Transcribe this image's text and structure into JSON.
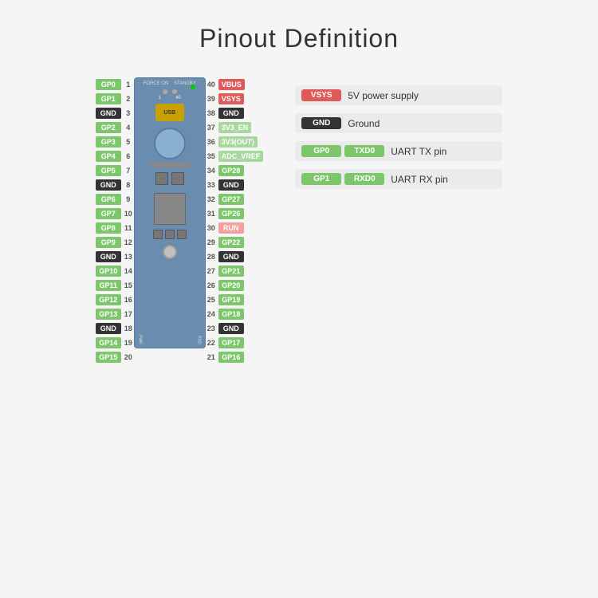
{
  "title": "Pinout Definition",
  "left_pins": [
    {
      "label": "GP0",
      "num": "1",
      "color": "green"
    },
    {
      "label": "GP1",
      "num": "2",
      "color": "green"
    },
    {
      "label": "GND",
      "num": "3",
      "color": "black"
    },
    {
      "label": "GP2",
      "num": "4",
      "color": "green"
    },
    {
      "label": "GP3",
      "num": "5",
      "color": "green"
    },
    {
      "label": "GP4",
      "num": "6",
      "color": "green"
    },
    {
      "label": "GP5",
      "num": "7",
      "color": "green"
    },
    {
      "label": "GND",
      "num": "8",
      "color": "black"
    },
    {
      "label": "GP6",
      "num": "9",
      "color": "green"
    },
    {
      "label": "GP7",
      "num": "10",
      "color": "green"
    },
    {
      "label": "GP8",
      "num": "11",
      "color": "green"
    },
    {
      "label": "GP9",
      "num": "12",
      "color": "green"
    },
    {
      "label": "GND",
      "num": "13",
      "color": "black"
    },
    {
      "label": "GP10",
      "num": "14",
      "color": "green"
    },
    {
      "label": "GP11",
      "num": "15",
      "color": "green"
    },
    {
      "label": "GP12",
      "num": "16",
      "color": "green"
    },
    {
      "label": "GP13",
      "num": "17",
      "color": "green"
    },
    {
      "label": "GND",
      "num": "18",
      "color": "black"
    },
    {
      "label": "GP14",
      "num": "19",
      "color": "green"
    },
    {
      "label": "GP15",
      "num": "20",
      "color": "green"
    }
  ],
  "right_pins": [
    {
      "label": "VBUS",
      "num": "40",
      "color": "red"
    },
    {
      "label": "VSYS",
      "num": "39",
      "color": "red"
    },
    {
      "label": "GND",
      "num": "38",
      "color": "black"
    },
    {
      "label": "3V3_EN",
      "num": "37",
      "color": "light-green"
    },
    {
      "label": "3V3(OUT)",
      "num": "36",
      "color": "light-green"
    },
    {
      "label": "ADC_VREF",
      "num": "35",
      "color": "light-green"
    },
    {
      "label": "GP28",
      "num": "34",
      "color": "green"
    },
    {
      "label": "GND",
      "num": "33",
      "color": "black"
    },
    {
      "label": "GP27",
      "num": "32",
      "color": "green"
    },
    {
      "label": "GP26",
      "num": "31",
      "color": "green"
    },
    {
      "label": "RUN",
      "num": "30",
      "color": "pink"
    },
    {
      "label": "GP22",
      "num": "29",
      "color": "green"
    },
    {
      "label": "GND",
      "num": "28",
      "color": "black"
    },
    {
      "label": "GP21",
      "num": "27",
      "color": "green"
    },
    {
      "label": "GP20",
      "num": "26",
      "color": "green"
    },
    {
      "label": "GP19",
      "num": "25",
      "color": "green"
    },
    {
      "label": "GP18",
      "num": "24",
      "color": "green"
    },
    {
      "label": "GND",
      "num": "23",
      "color": "black"
    },
    {
      "label": "GP17",
      "num": "22",
      "color": "green"
    },
    {
      "label": "GP16",
      "num": "21",
      "color": "green"
    }
  ],
  "legend": [
    {
      "badges": [
        {
          "text": "VSYS",
          "color": "red"
        }
      ],
      "description": "5V power supply"
    },
    {
      "badges": [
        {
          "text": "GND",
          "color": "black"
        }
      ],
      "description": "Ground"
    },
    {
      "badges": [
        {
          "text": "GP0",
          "color": "green"
        },
        {
          "text": "TXD0",
          "color": "green"
        }
      ],
      "description": "UART TX pin"
    },
    {
      "badges": [
        {
          "text": "GP1",
          "color": "green"
        },
        {
          "text": "RXD0",
          "color": "green"
        }
      ],
      "description": "UART RX pin"
    }
  ],
  "board": {
    "force_on": "FORCE ON",
    "standby": "STANDBY",
    "usb": "USB"
  }
}
